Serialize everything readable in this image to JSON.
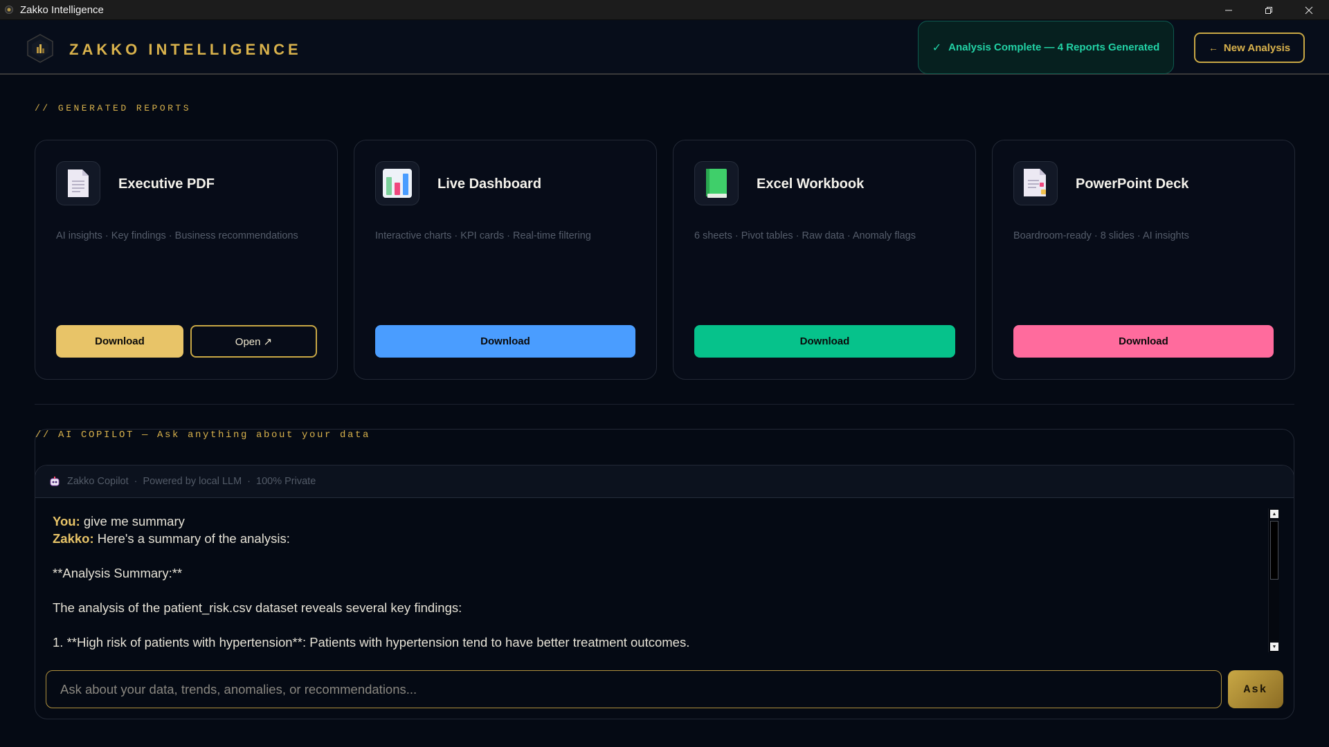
{
  "window": {
    "title": "Zakko Intelligence"
  },
  "header": {
    "brand": "ZAKKO  INTELLIGENCE",
    "status": "Analysis Complete — 4 Reports Generated",
    "new_analysis": "New Analysis"
  },
  "colors": {
    "accent_gold": "#d9b24c",
    "status_green": "#22d3a6",
    "pdf_button": "#e8c468",
    "dashboard_button": "#4a9dff",
    "excel_button": "#06c28b",
    "powerpoint_button": "#ff6b9d"
  },
  "reports_section": {
    "label": "// GENERATED REPORTS",
    "cards": [
      {
        "title": "Executive PDF",
        "icon": "document-icon",
        "description": "AI insights · Key findings · Business recommendations",
        "download": "Download",
        "open": "Open ↗"
      },
      {
        "title": "Live Dashboard",
        "icon": "bar-chart-icon",
        "description": "Interactive charts · KPI cards · Real-time filtering",
        "download": "Download"
      },
      {
        "title": "Excel Workbook",
        "icon": "green-book-icon",
        "description": "6 sheets · Pivot tables · Raw data · Anomaly flags",
        "download": "Download"
      },
      {
        "title": "PowerPoint Deck",
        "icon": "presentation-document-icon",
        "description": "Boardroom-ready · 8 slides · AI insights",
        "download": "Download"
      }
    ]
  },
  "copilot": {
    "section_label": "// AI COPILOT — Ask anything about your data",
    "name": "Zakko Copilot",
    "powered_by": "Powered by local LLM",
    "privacy": "100% Private",
    "messages": [
      {
        "speaker": "You:",
        "text": " give me summary"
      },
      {
        "speaker": "Zakko:",
        "text": " Here's a summary of the analysis:"
      }
    ],
    "response_lines": [
      "**Analysis Summary:**",
      "The analysis of the patient_risk.csv dataset reveals several key findings:",
      "1. **High risk of patients with hypertension**: Patients with hypertension tend to have better treatment outcomes."
    ],
    "input_placeholder": "Ask about your data, trends, anomalies, or recommendations...",
    "input_value": "",
    "ask_label": "Ask"
  }
}
